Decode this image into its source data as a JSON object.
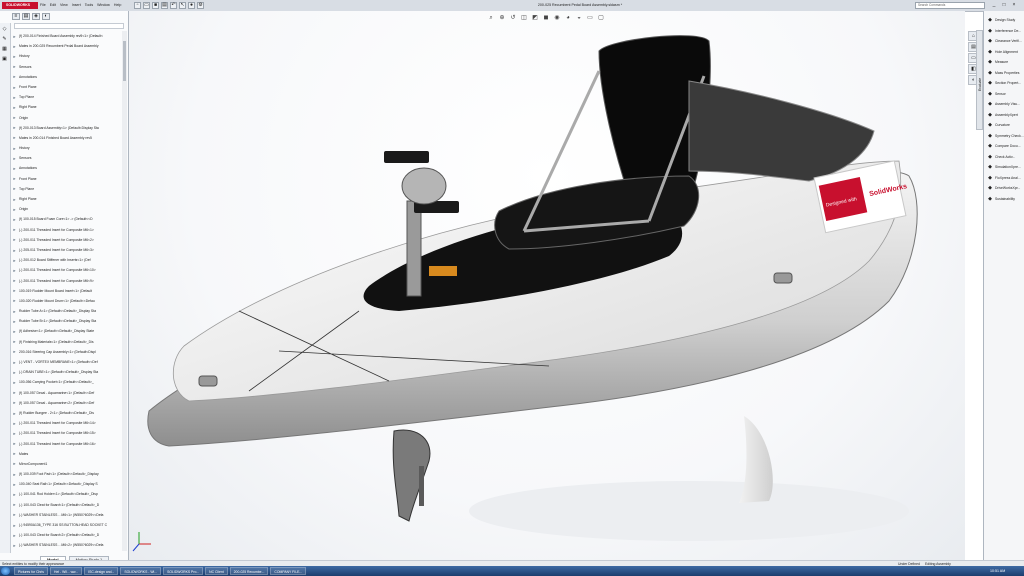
{
  "app": {
    "logo_text": "SOLIDWORKS"
  },
  "menus": [
    "File",
    "Edit",
    "View",
    "Insert",
    "Tools",
    "Window",
    "Help"
  ],
  "quick_access_icons": [
    "new-icon",
    "open-icon",
    "save-icon",
    "print-icon",
    "undo-icon",
    "select-icon",
    "rebuild-icon",
    "options-icon"
  ],
  "title": "200-025 Recumbent Pedal Board Assembly.sldasm *",
  "search": {
    "placeholder": "Search Commands"
  },
  "window_controls": [
    "_",
    "□",
    "×"
  ],
  "feature_manager": {
    "tabs": [
      "tree-icon",
      "property-icon",
      "config-icon",
      "display-icon"
    ],
    "items": [
      "(f) 200-014 Finished Board Assembly rev5<1> (Default<",
      "Mates in 200-025 Recumbent Pedal Board Assembly",
      "History",
      "Sensors",
      "Annotations",
      "Front Plane",
      "Top Plane",
      "Right Plane",
      "Origin",
      "(f) 200-013 Board Assembly<1> (Default<Display Sta",
      "Mates in 200-014 Finished Board Assembly rev5",
      "History",
      "Sensors",
      "Annotations",
      "Front Plane",
      "Top Plane",
      "Right Plane",
      "Origin",
      "(f) 100-015 Board Foam Core<1> -> (Default<<D",
      "(-) 200-011 Threaded Insert for Composite M6<1>",
      "(-) 200-011 Threaded Insert for Composite M6<2>",
      "(-) 205-011 Threaded Insert for Composite M6<3>",
      "(-) 200-012 Board Stiffener with Inserts<1> (Def",
      "(-) 200-011 Threaded Insert for Composite M6<10>",
      "(-) 200-011 Threaded Insert for Composite M6<9>",
      "100-019 Rudder Mount Board Insert<1> (Default",
      "100-020 Rudder Mount Drum<1> (Default<<Defau",
      "Rudder Tube A<1> (Default<<Default>_Display Sta",
      "Rudder Tube B<1> (Default<<Default>_Display Sta",
      "(f) Adhesive<1> (Default<<Default>_Display State",
      "(f) Finishing Materials<1> (Default<<Default>_Dis",
      "200-016 Steering Cap Assembly<1> (Default<Displ",
      "(-) VENT - VORTEX MEMBRANE<1> (Default<<Def",
      "(-) DRAIN TUBE<1> (Default<<Default>_Display Sta",
      "100-056 Carrying Pocket<1> (Default<<Default>_",
      "(f) 100-057 Decal - Aquamarine<1> (Default<<Def",
      "(f) 100-057 Decal - Aquamarine<2> (Default<<Def",
      "(f) Rudder Bungee - 2<1> (Default<<Default>_Dis",
      "(-) 200-011 Threaded Insert for Composite M6<14>",
      "(-) 200-011 Threaded Insert for Composite M6<15>",
      "(-) 200-011 Threaded Insert for Composite M6<16>",
      "Mates",
      "MirrorComponent1",
      "(f) 100-039 Foot Pad<1> (Default<<Default>_Display",
      "100-040 Seat Rail<1> (Default<<Default>_Display S",
      "(-) 100-041 Rod Holder<1> (Default<<Default>_Disp",
      "(-) 100-043 Cleat for Board<1> (Default<<Default>_D",
      "(-) WASHER STAINLESS - .M6<1> (W550?6029<<Defa",
      "(-) 94590A136_TYPE 316 SS BUTTON-HEAD SOCKET C",
      "(-) 100-043 Cleat for Board<2> (Default<<Default>_D",
      "(-) WASHER STAINLESS - .M6<2> (W550?6029<<Defa"
    ],
    "bottom_tabs": [
      "Model",
      "Motion Study 1"
    ]
  },
  "viewport": {
    "view_tools": [
      "zoom-fit-icon",
      "zoom-area-icon",
      "prev-view-icon",
      "section-view-icon",
      "view-orient-icon",
      "display-style-icon",
      "hide-show-icon",
      "edit-appearance-icon",
      "apply-scene-icon",
      "view-settings-icon",
      "monitor-icon"
    ],
    "decal_text": "Designed with",
    "decal_brand": "SolidWorks"
  },
  "task_pane": {
    "items": [
      {
        "label": "Design Study",
        "icon": "study-icon"
      },
      {
        "label": "Interference De...",
        "icon": "interference-icon"
      },
      {
        "label": "Clearance Verifi...",
        "icon": "clearance-icon"
      },
      {
        "label": "Hole Alignment",
        "icon": "hole-icon"
      },
      {
        "label": "Measure",
        "icon": "measure-icon"
      },
      {
        "label": "Mass Properties",
        "icon": "mass-icon"
      },
      {
        "label": "Section Propert...",
        "icon": "section-icon"
      },
      {
        "label": "Sensor",
        "icon": "sensor-icon"
      },
      {
        "label": "Assembly Visu...",
        "icon": "assembly-vis-icon"
      },
      {
        "label": "AssemblyXpert",
        "icon": "xpert-icon"
      },
      {
        "label": "Curvature",
        "icon": "curvature-icon"
      },
      {
        "label": "Symmetry Check...",
        "icon": "symmetry-icon"
      },
      {
        "label": "Compare Docu...",
        "icon": "compare-icon"
      },
      {
        "label": "Check Activ...",
        "icon": "check-icon"
      },
      {
        "label": "SimulationXpre...",
        "icon": "simulation-icon"
      },
      {
        "label": "FloXpress Anal...",
        "icon": "floxpress-icon"
      },
      {
        "label": "DriveWorksXpr...",
        "icon": "driveworks-icon"
      },
      {
        "label": "Sustainability",
        "icon": "sustainability-icon"
      }
    ],
    "vertical_tab": "Evaluate"
  },
  "status": {
    "left": "Select entities to modify their appearance",
    "right1": "Under Defined",
    "right2": "Editing Assembly"
  },
  "taskbar": {
    "items": [
      "Pictures for Chris",
      "Hel - Wil... ww...",
      "ISC-design and...",
      "SOLIDWORKS - Wi...",
      "SOLIDWORKS Pro...",
      "NC Client",
      "200-025 Recumbe...",
      "COMPANY FILE..."
    ],
    "clock": "10:51 AM"
  },
  "colors": {
    "brand_red": "#c8102e",
    "taskbar": "#1c3d6e"
  }
}
